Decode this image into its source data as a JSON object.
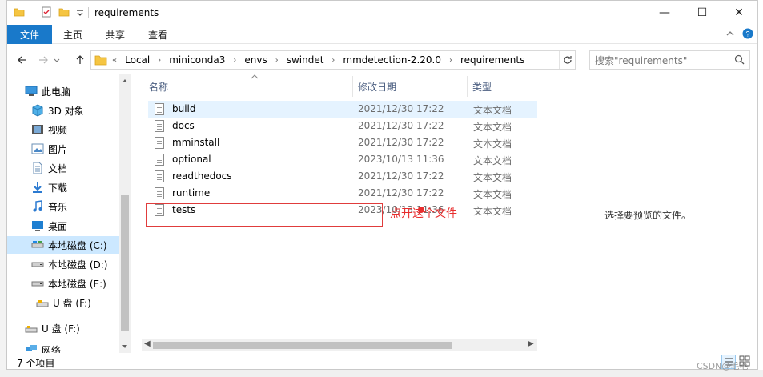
{
  "window": {
    "title": "requirements",
    "controls": {
      "minimize": "—",
      "maximize": "☐",
      "close": "✕"
    }
  },
  "ribbon": {
    "file_tab": "文件",
    "tabs": [
      "主页",
      "共享",
      "查看"
    ]
  },
  "address": {
    "overflow": "«",
    "breadcrumb": [
      "Local",
      "miniconda3",
      "envs",
      "swindet",
      "mmdetection-2.20.0",
      "requirements"
    ],
    "search_placeholder": "搜索\"requirements\""
  },
  "nav": {
    "items": [
      {
        "label": "此电脑",
        "icon": "computer-icon"
      },
      {
        "label": "3D 对象",
        "icon": "cube-icon"
      },
      {
        "label": "视频",
        "icon": "video-icon"
      },
      {
        "label": "图片",
        "icon": "picture-icon"
      },
      {
        "label": "文档",
        "icon": "document-icon"
      },
      {
        "label": "下载",
        "icon": "download-icon"
      },
      {
        "label": "音乐",
        "icon": "music-icon"
      },
      {
        "label": "桌面",
        "icon": "desktop-icon"
      },
      {
        "label": "本地磁盘 (C:)",
        "icon": "drive-icon",
        "selected": true
      },
      {
        "label": "本地磁盘 (D:)",
        "icon": "drive-icon"
      },
      {
        "label": "本地磁盘 (E:)",
        "icon": "drive-icon"
      },
      {
        "label": "U 盘 (F:)",
        "icon": "usb-drive-icon"
      },
      {
        "label": "U 盘 (F:)",
        "icon": "usb-drive-icon"
      },
      {
        "label": "网络",
        "icon": "network-icon"
      }
    ]
  },
  "filelist": {
    "columns": [
      "名称",
      "修改日期",
      "类型"
    ],
    "sort_indicator": "⌃",
    "rows": [
      {
        "name": "build",
        "date": "2021/12/30 17:22",
        "type": "文本文档"
      },
      {
        "name": "docs",
        "date": "2021/12/30 17:22",
        "type": "文本文档"
      },
      {
        "name": "mminstall",
        "date": "2021/12/30 17:22",
        "type": "文本文档"
      },
      {
        "name": "optional",
        "date": "2023/10/13 11:36",
        "type": "文本文档"
      },
      {
        "name": "readthedocs",
        "date": "2021/12/30 17:22",
        "type": "文本文档"
      },
      {
        "name": "runtime",
        "date": "2021/12/30 17:22",
        "type": "文本文档"
      },
      {
        "name": "tests",
        "date": "2023/10/13 11:36",
        "type": "文本文档"
      }
    ]
  },
  "preview": {
    "empty_text": "选择要预览的文件。"
  },
  "status": {
    "item_count": "7 个项目"
  },
  "annotation": {
    "text": "点开这个文件",
    "color": "#e82d2d"
  },
  "watermark": "CSDN@毛毛"
}
